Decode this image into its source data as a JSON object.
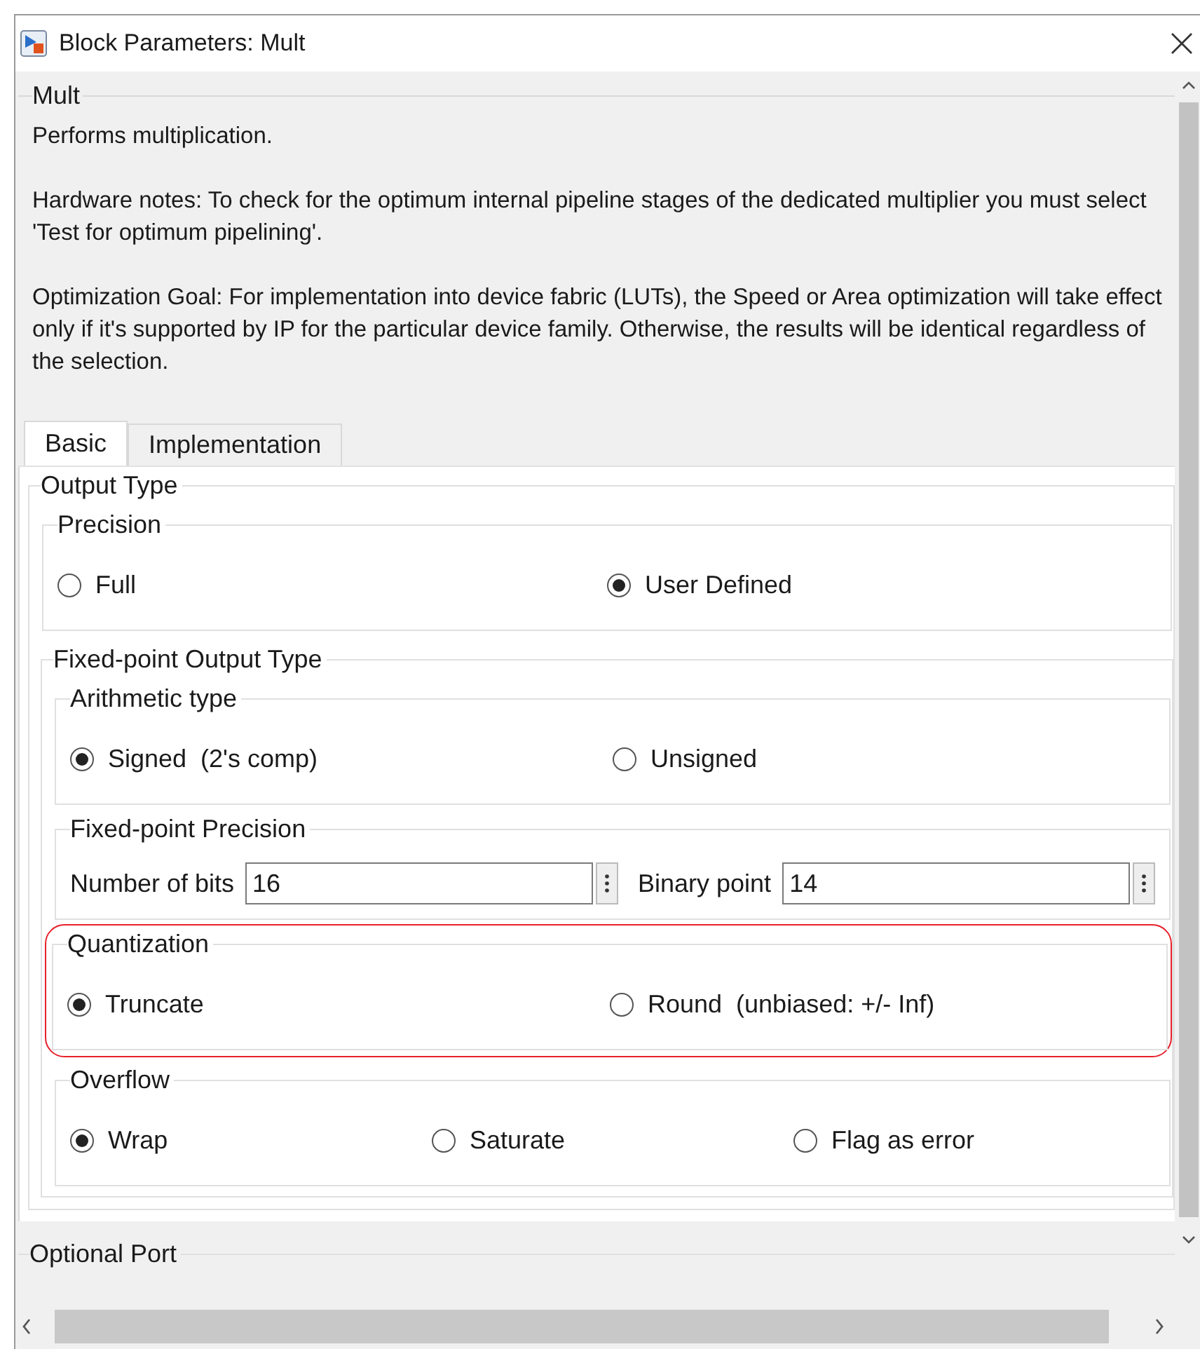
{
  "window": {
    "title": "Block Parameters: Mult"
  },
  "block": {
    "name": "Mult",
    "description": [
      "Performs multiplication.",
      "Hardware notes: To check for the optimum internal pipeline stages of the dedicated multiplier you must select 'Test for optimum pipelining'.",
      "Optimization Goal: For implementation into device fabric (LUTs), the Speed or Area optimization will take effect only if it's supported by IP for the particular device family. Otherwise, the results will be identical regardless of the selection."
    ]
  },
  "tabs": [
    {
      "label": "Basic",
      "selected": true
    },
    {
      "label": "Implementation",
      "selected": false
    }
  ],
  "sections": [
    {
      "title": "Output Type",
      "groups": [
        {
          "kind": "radio",
          "title": "Precision",
          "highlighted": false,
          "options": [
            {
              "label": "Full",
              "selected": false
            },
            {
              "label": "User Defined",
              "selected": true
            }
          ]
        },
        {
          "kind": "container",
          "title": "Fixed-point Output Type",
          "groups": [
            {
              "kind": "radio",
              "title": "Arithmetic type",
              "highlighted": false,
              "options": [
                {
                  "label": "Signed  (2's comp)",
                  "selected": true
                },
                {
                  "label": "Unsigned",
                  "selected": false
                }
              ]
            },
            {
              "kind": "fields",
              "title": "Fixed-point Precision",
              "highlighted": false,
              "fields": [
                {
                  "label": "Number of bits",
                  "value": "16"
                },
                {
                  "label": "Binary point",
                  "value": "14"
                }
              ]
            },
            {
              "kind": "radio",
              "title": "Quantization",
              "highlighted": true,
              "options": [
                {
                  "label": "Truncate",
                  "selected": true
                },
                {
                  "label": "Round  (unbiased: +/- Inf)",
                  "selected": false
                }
              ]
            },
            {
              "kind": "radio",
              "title": "Overflow",
              "highlighted": false,
              "options": [
                {
                  "label": "Wrap",
                  "selected": true
                },
                {
                  "label": "Saturate",
                  "selected": false
                },
                {
                  "label": "Flag as error",
                  "selected": false
                }
              ]
            }
          ]
        }
      ]
    },
    {
      "title": "Optional Port"
    }
  ]
}
